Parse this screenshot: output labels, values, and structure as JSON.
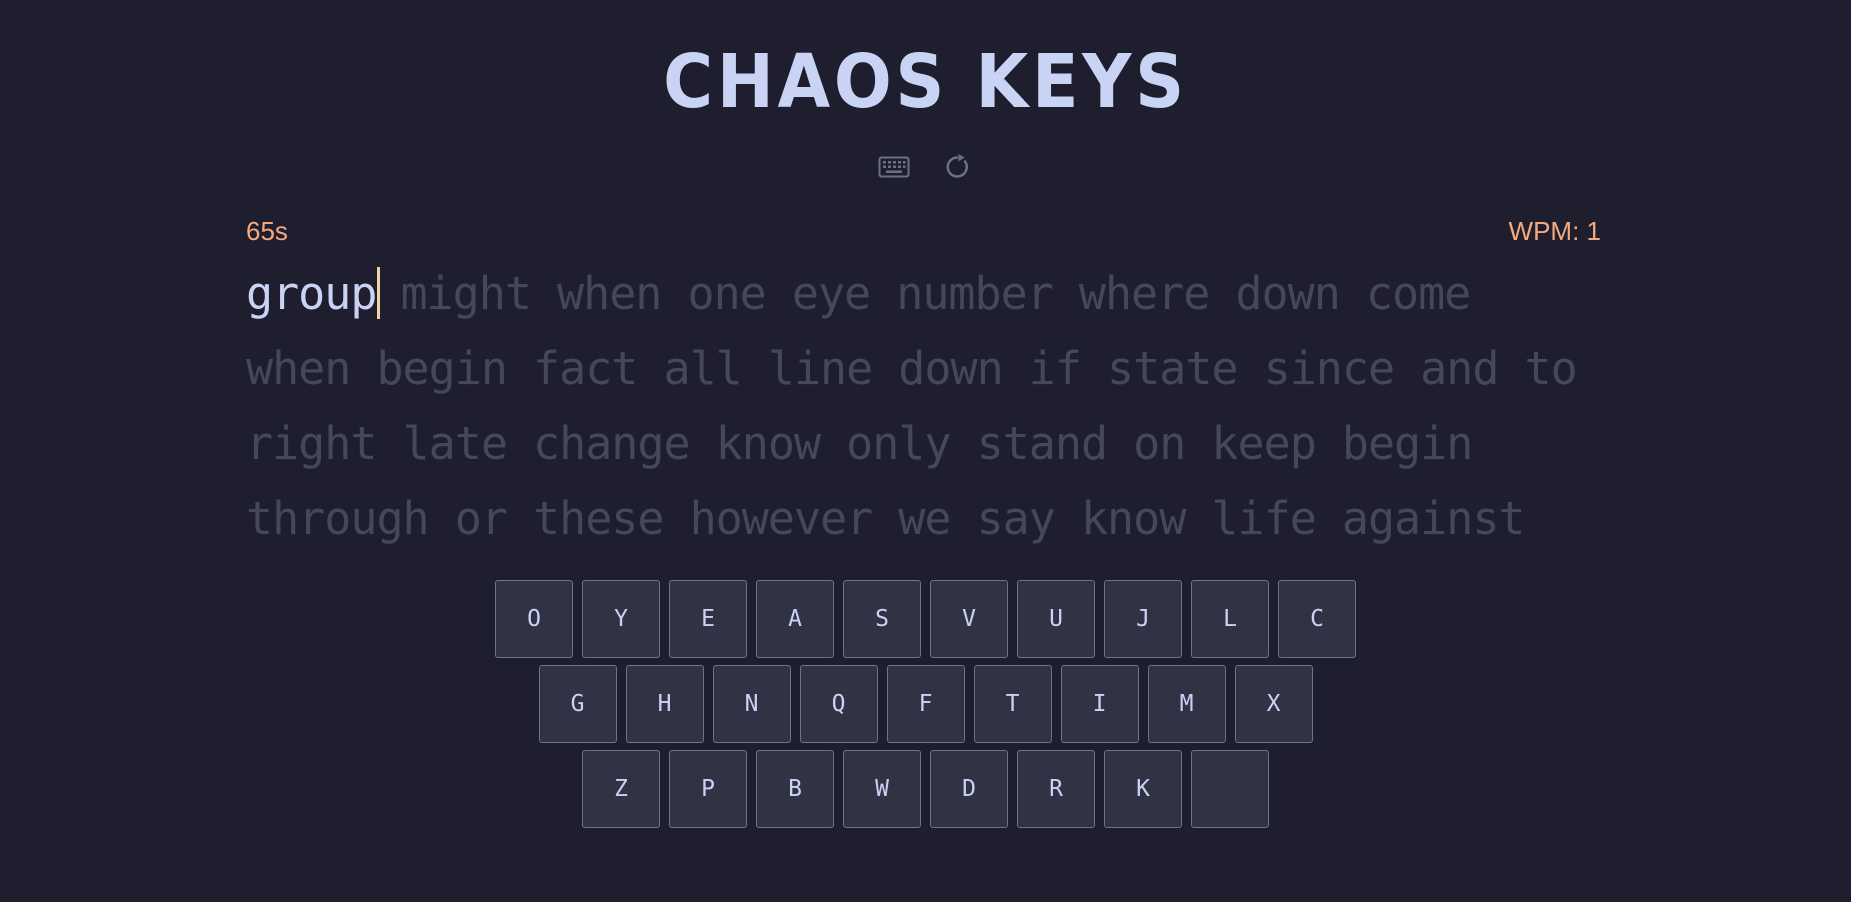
{
  "app": {
    "title": "CHAOS KEYS"
  },
  "toolbar": {
    "keyboard_icon": "keyboard-icon",
    "restart_icon": "restart-icon"
  },
  "stats": {
    "timer": "65s",
    "wpm": "WPM: 1"
  },
  "text": {
    "typed_word": "group",
    "lines": [
      "might when one eye number where down come",
      "when begin fact all line down if state since and to",
      "right late change know only stand on keep begin",
      "through or these however we say know life against"
    ]
  },
  "keyboard": {
    "rows": [
      [
        "O",
        "Y",
        "E",
        "A",
        "S",
        "V",
        "U",
        "J",
        "L",
        "C"
      ],
      [
        "G",
        "H",
        "N",
        "Q",
        "F",
        "T",
        "I",
        "M",
        "X"
      ],
      [
        "Z",
        "P",
        "B",
        "W",
        "D",
        "R",
        "K",
        ""
      ]
    ]
  },
  "colors": {
    "background": "#1e1e2e",
    "title": "#c9d4f5",
    "accent": "#f5a97f",
    "typed_text": "#cad3f5",
    "untyped_text": "#45475a",
    "caret": "#eed49f",
    "key_background": "#313244",
    "key_border": "#6e738d"
  }
}
